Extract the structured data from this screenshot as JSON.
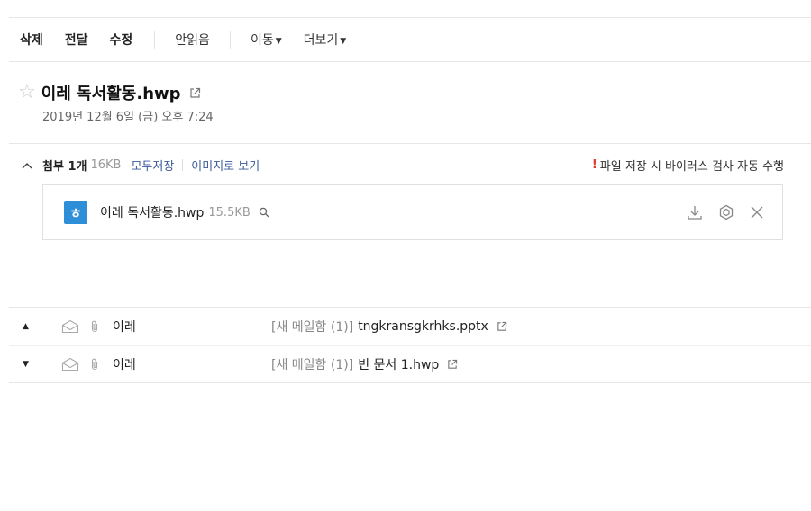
{
  "toolbar": {
    "delete": "삭제",
    "forward": "전달",
    "edit": "수정",
    "mark_unread": "안읽음",
    "move": "이동",
    "more": "더보기"
  },
  "mail": {
    "subject": "이레 독서활동.hwp",
    "date": "2019년 12월 6일 (금) 오후 7:24"
  },
  "attachments": {
    "label": "첨부 1개",
    "total_size": "16KB",
    "save_all": "모두저장",
    "view_as_image": "이미지로 보기",
    "warning_icon": "!",
    "warning": "파일 저장 시 바이러스 검사 자동 수행",
    "files": [
      {
        "icon_letter": "ㅎ",
        "name": "이레 독서활동.hwp",
        "size": "15.5KB"
      }
    ]
  },
  "mail_list": [
    {
      "direction": "up",
      "arrow": "▲",
      "sender": "이레",
      "folder": "[새 메일함 (1)]",
      "subject": "tngkransgkrhks.pptx"
    },
    {
      "direction": "down",
      "arrow": "▼",
      "sender": "이레",
      "folder": "[새 메일함 (1)]",
      "subject": "빈 문서 1.hwp"
    }
  ],
  "colors": {
    "link": "#3a5a98",
    "hwp_icon": "#2f8ed8",
    "warning": "#e23b2e"
  }
}
